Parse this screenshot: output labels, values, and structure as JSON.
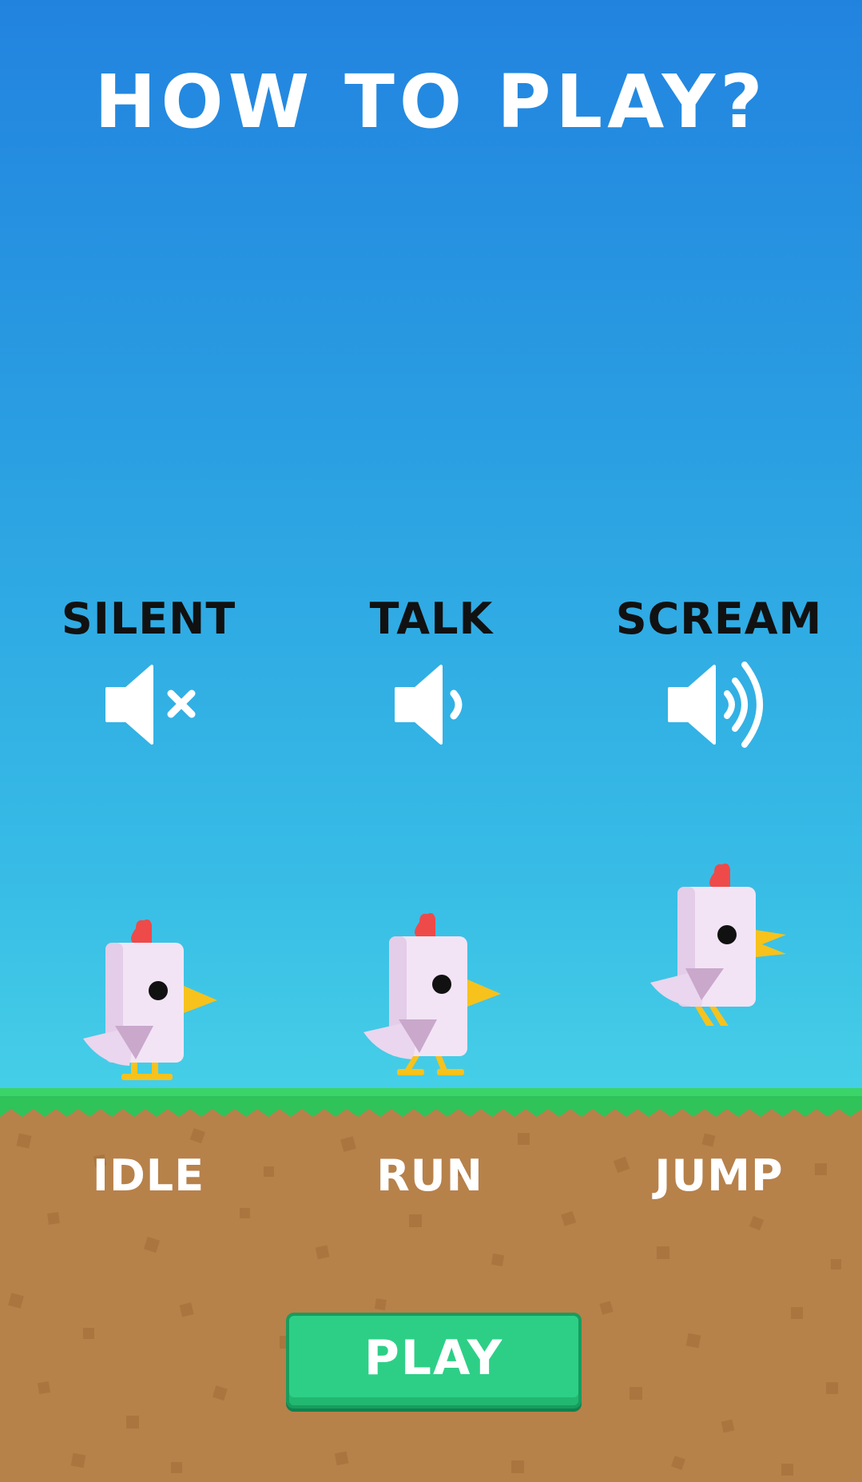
{
  "title": "HOW TO PLAY?",
  "voice_modes": [
    {
      "label": "SILENT",
      "icon": "speaker-muted-icon"
    },
    {
      "label": "TALK",
      "icon": "speaker-low-icon"
    },
    {
      "label": "SCREAM",
      "icon": "speaker-loud-icon"
    }
  ],
  "actions": [
    {
      "label": "IDLE",
      "icon": "chicken-idle-icon"
    },
    {
      "label": "RUN",
      "icon": "chicken-run-icon"
    },
    {
      "label": "JUMP",
      "icon": "chicken-jump-icon"
    }
  ],
  "play_button": {
    "label": "PLAY"
  },
  "colors": {
    "sky_top": "#2283df",
    "sky_bottom": "#46cfe7",
    "grass": "#2fc35a",
    "dirt": "#b7814a",
    "button": "#2dcf86",
    "chicken_body": "#f2e4f5",
    "chicken_comb": "#ee4a4a",
    "chicken_beak": "#f7c21c"
  }
}
